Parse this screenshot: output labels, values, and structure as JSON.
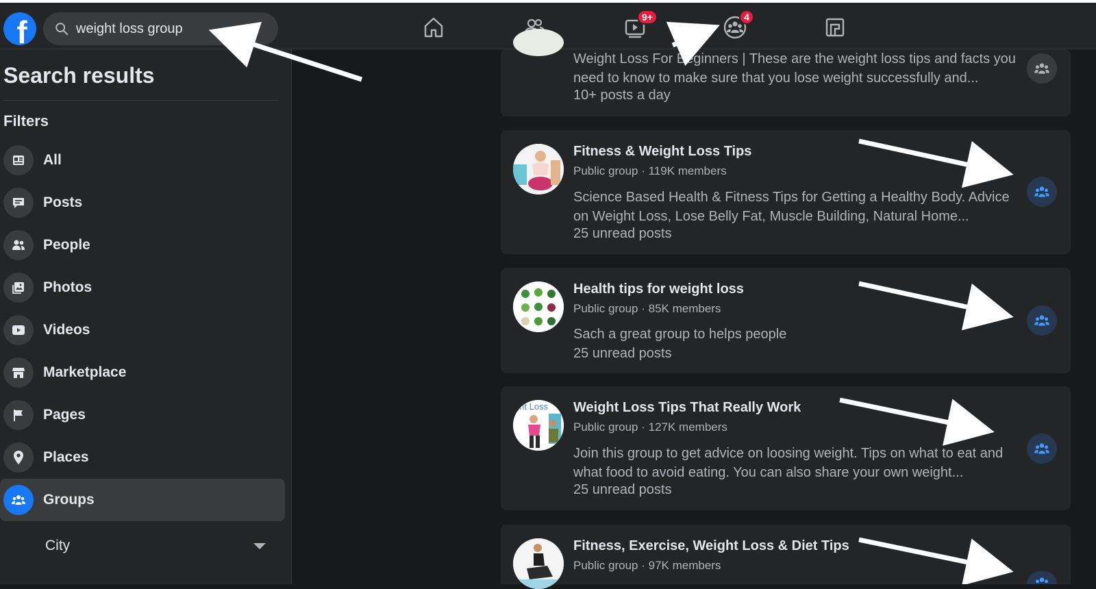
{
  "header": {
    "logo_letter": "f",
    "search": {
      "value": "weight loss group",
      "icon": "search-icon"
    },
    "nav": [
      {
        "name": "home",
        "icon": "home-icon",
        "badge": ""
      },
      {
        "name": "friends",
        "icon": "friends-icon",
        "badge": ""
      },
      {
        "name": "watch",
        "icon": "watch-icon",
        "badge": "9+"
      },
      {
        "name": "groups",
        "icon": "groups-icon",
        "badge": "4"
      },
      {
        "name": "gaming",
        "icon": "gaming-icon",
        "badge": ""
      }
    ]
  },
  "sidebar": {
    "title": "Search results",
    "filters_title": "Filters",
    "filters": [
      {
        "label": "All",
        "icon": "feed-icon",
        "active": false
      },
      {
        "label": "Posts",
        "icon": "posts-icon",
        "active": false
      },
      {
        "label": "People",
        "icon": "people-icon",
        "active": false
      },
      {
        "label": "Photos",
        "icon": "photos-icon",
        "active": false
      },
      {
        "label": "Videos",
        "icon": "videos-icon",
        "active": false
      },
      {
        "label": "Marketplace",
        "icon": "marketplace-icon",
        "active": false
      },
      {
        "label": "Pages",
        "icon": "flag-icon",
        "active": false
      },
      {
        "label": "Places",
        "icon": "location-pin-icon",
        "active": false
      },
      {
        "label": "Groups",
        "icon": "groups-icon",
        "active": true
      }
    ],
    "city": {
      "label": "City",
      "icon": "caret-down-icon"
    }
  },
  "results": [
    {
      "title": "",
      "meta": "",
      "description": "Weight Loss For Beginners | These are the weight loss tips and facts you need to know to make sure that you lose weight successfully and...",
      "posts": "10+ posts a day"
    },
    {
      "title": "Fitness & Weight Loss Tips",
      "meta": "Public group · 119K members",
      "description": "Science Based Health & Fitness Tips for Getting a Healthy Body. Advice on Weight Loss, Lose Belly Fat, Muscle Building, Natural Home...",
      "posts": "25 unread posts"
    },
    {
      "title": "Health tips for weight loss",
      "meta": "Public group · 85K members",
      "description": "Sach a great group to helps people",
      "posts": "25 unread posts"
    },
    {
      "title": "Weight Loss Tips That Really Work",
      "meta": "Public group · 127K members",
      "description": "Join this group to get advice on loosing weight. Tips on what to eat and what food to avoid eating. You can also share your own weight...",
      "posts": "25 unread posts",
      "avatar_text": "ght Loss"
    },
    {
      "title": "Fitness, Exercise, Weight Loss & Diet Tips",
      "meta": "Public group · 97K members",
      "description": "",
      "posts": ""
    }
  ],
  "colors": {
    "accent": "#1877f2",
    "badge": "#e41e3f",
    "surface": "#242526",
    "background": "#18191a"
  }
}
